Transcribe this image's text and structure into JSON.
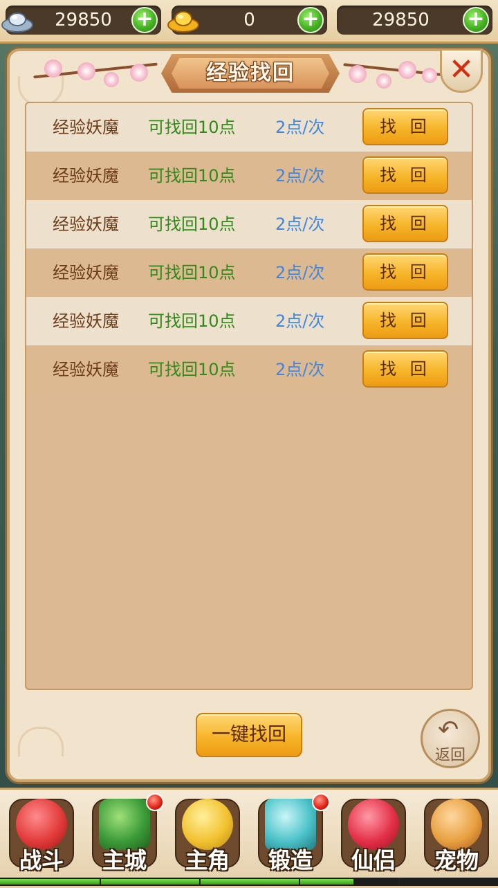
{
  "currency": [
    {
      "icon": "silver-ingot-icon",
      "value": "29850"
    },
    {
      "icon": "gold-ingot-icon",
      "value": "0"
    },
    {
      "icon": "",
      "value": "29850"
    }
  ],
  "dialog": {
    "title": "经验找回",
    "close_label": "✕",
    "rows": [
      {
        "name": "经验妖魔",
        "available": "可找回10点",
        "cost": "2点/次",
        "button": "找 回"
      },
      {
        "name": "经验妖魔",
        "available": "可找回10点",
        "cost": "2点/次",
        "button": "找 回"
      },
      {
        "name": "经验妖魔",
        "available": "可找回10点",
        "cost": "2点/次",
        "button": "找 回"
      },
      {
        "name": "经验妖魔",
        "available": "可找回10点",
        "cost": "2点/次",
        "button": "找 回"
      },
      {
        "name": "经验妖魔",
        "available": "可找回10点",
        "cost": "2点/次",
        "button": "找 回"
      },
      {
        "name": "经验妖魔",
        "available": "可找回10点",
        "cost": "2点/次",
        "button": "找 回"
      }
    ],
    "retrieve_all": "一键找回",
    "back_label": "返回"
  },
  "bottom_nav": [
    {
      "label": "战斗",
      "icon": "red-ninja-icon",
      "badge": false,
      "color": "#e23b3b"
    },
    {
      "label": "主城",
      "icon": "city-gate-icon",
      "badge": true,
      "color": "#3d9c3a"
    },
    {
      "label": "主角",
      "icon": "yellow-hero-icon",
      "badge": false,
      "color": "#f2c230"
    },
    {
      "label": "锻造",
      "icon": "hammer-icon",
      "badge": true,
      "color": "#4cc3c9"
    },
    {
      "label": "仙侣",
      "icon": "heart-flower-icon",
      "badge": false,
      "color": "#e23048"
    },
    {
      "label": "宠物",
      "icon": "monkey-pet-icon",
      "badge": false,
      "color": "#e8a040"
    }
  ],
  "progress": 0.71
}
